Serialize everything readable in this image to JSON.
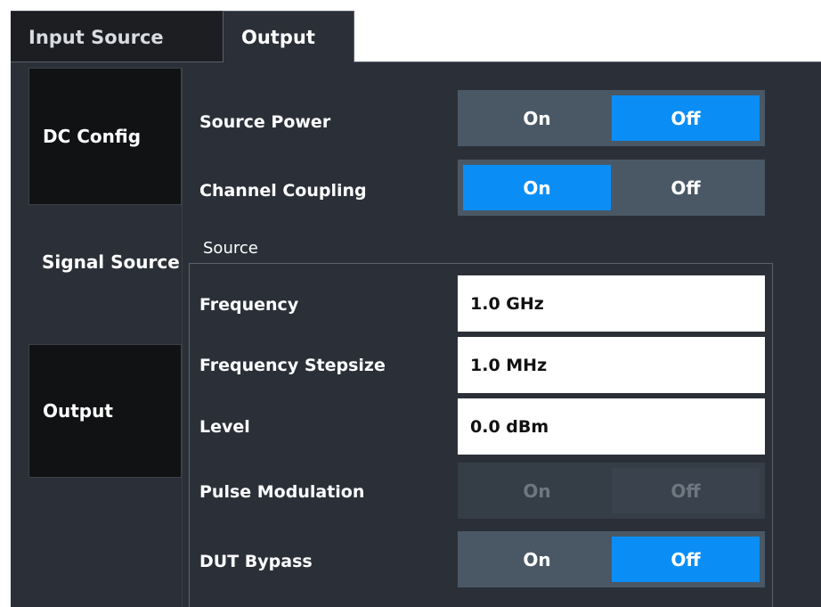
{
  "tabs": [
    {
      "label": "Input Source",
      "active": false
    },
    {
      "label": "Output",
      "active": true
    }
  ],
  "sidebar": {
    "items": [
      {
        "label": "DC Config",
        "active": false
      },
      {
        "label": "Signal Source",
        "active": true
      },
      {
        "label": "Output",
        "active": false
      }
    ]
  },
  "settings": {
    "source_power": {
      "label": "Source Power",
      "on": "On",
      "off": "Off",
      "selected": "Off"
    },
    "channel_coupling": {
      "label": "Channel Coupling",
      "on": "On",
      "off": "Off",
      "selected": "On"
    }
  },
  "source": {
    "title": "Source",
    "frequency": {
      "label": "Frequency",
      "value": "1.0 GHz"
    },
    "frequency_stepsize": {
      "label": "Frequency Stepsize",
      "value": "1.0 MHz"
    },
    "level": {
      "label": "Level",
      "value": "0.0 dBm"
    },
    "pulse_modulation": {
      "label": "Pulse Modulation",
      "on": "On",
      "off": "Off",
      "enabled": false
    },
    "dut_bypass": {
      "label": "DUT Bypass",
      "on": "On",
      "off": "Off",
      "selected": "Off"
    }
  },
  "colors": {
    "accent": "#0a8ef6",
    "panel": "#2b3038",
    "toggle_bg": "#4a5866",
    "dark": "#111214"
  }
}
